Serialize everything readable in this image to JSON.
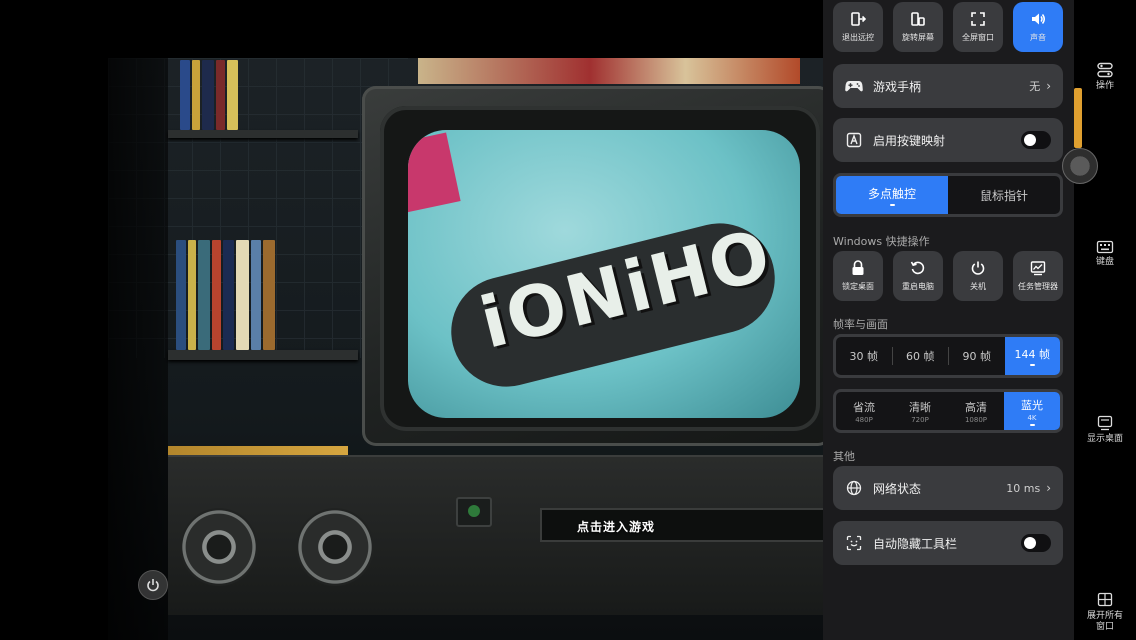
{
  "game": {
    "logo_text": "iONiHO",
    "click_prompt": "点击进入游戏"
  },
  "top_actions": [
    {
      "label": "退出远控",
      "icon": "exit-icon"
    },
    {
      "label": "旋转屏幕",
      "icon": "rotate-screen-icon"
    },
    {
      "label": "全屏窗口",
      "icon": "fullscreen-icon"
    },
    {
      "label": "声音",
      "icon": "speaker-icon",
      "active": true
    }
  ],
  "gamepad": {
    "label": "游戏手柄",
    "value": "无",
    "chevron": "›"
  },
  "key_mapping": {
    "label": "启用按键映射",
    "enabled": false
  },
  "input_mode": {
    "options": [
      "多点触控",
      "鼠标指针"
    ],
    "selected": "多点触控"
  },
  "windows_section": {
    "title": "Windows 快捷操作",
    "buttons": [
      {
        "label": "锁定桌面",
        "icon": "lock-icon"
      },
      {
        "label": "重启电脑",
        "icon": "restart-icon"
      },
      {
        "label": "关机",
        "icon": "power-icon"
      },
      {
        "label": "任务管理器",
        "icon": "task-manager-icon"
      }
    ]
  },
  "frame_section": {
    "title": "帧率与画面",
    "fps_options": [
      "30 帧",
      "60 帧",
      "90 帧",
      "144 帧"
    ],
    "fps_selected": "144 帧",
    "quality_options": [
      {
        "label": "省流",
        "sub": "480P"
      },
      {
        "label": "清晰",
        "sub": "720P"
      },
      {
        "label": "高清",
        "sub": "1080P"
      },
      {
        "label": "蓝光",
        "sub": "4K"
      }
    ],
    "quality_selected": "蓝光"
  },
  "other_section": {
    "title": "其他",
    "network": {
      "label": "网络状态",
      "value": "10 ms",
      "chevron": "›"
    },
    "auto_hide": {
      "label": "自动隐藏工具栏",
      "enabled": false
    }
  },
  "rail": [
    {
      "label": "操作",
      "icon": "controls-icon"
    },
    {
      "label": "键盘",
      "icon": "keyboard-icon"
    },
    {
      "label": "显示桌面",
      "icon": "show-desktop-icon"
    },
    {
      "label": "展开所有\n窗口",
      "icon": "expand-windows-icon"
    }
  ],
  "colors": {
    "accent": "#2f7cf6",
    "panel": "#1b1b1d",
    "card": "#3a3b3e"
  }
}
